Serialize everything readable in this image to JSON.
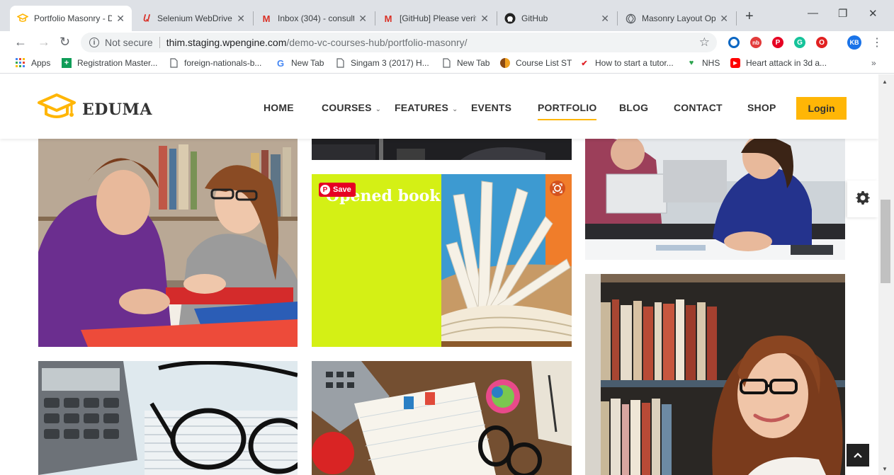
{
  "browser": {
    "tabs": [
      {
        "title": "Portfolio Masonry - D",
        "icon": "eduma-cap-icon",
        "active": true
      },
      {
        "title": "Selenium WebDriver",
        "icon": "selenium-icon",
        "active": false
      },
      {
        "title": "Inbox (304) - consult",
        "icon": "gmail-icon",
        "active": false
      },
      {
        "title": "[GitHub] Please verif",
        "icon": "gmail-icon",
        "active": false
      },
      {
        "title": "GitHub",
        "icon": "github-icon",
        "active": false
      },
      {
        "title": "Masonry Layout Opt",
        "icon": "globe-icon",
        "active": false
      }
    ],
    "address": {
      "security": "Not secure",
      "host": "thim.staging.wpengine.com",
      "path": "/demo-vc-courses-hub/portfolio-masonry/"
    },
    "profile_initials": "KB",
    "bookmarks": [
      {
        "label": "Apps",
        "icon": "apps-grid-icon"
      },
      {
        "label": "Registration Master...",
        "icon": "plus-square-icon"
      },
      {
        "label": "foreign-nationals-b...",
        "icon": "page-icon"
      },
      {
        "label": "New Tab",
        "icon": "google-icon"
      },
      {
        "label": "Singam 3 (2017) H...",
        "icon": "page-icon"
      },
      {
        "label": "New Tab",
        "icon": "page-icon"
      },
      {
        "label": "Course List ST",
        "icon": "brown-circle-icon"
      },
      {
        "label": "How to start a tutor...",
        "icon": "red-swoosh-icon"
      },
      {
        "label": "NHS",
        "icon": "shield-green-icon"
      },
      {
        "label": "Heart attack in 3d a...",
        "icon": "youtube-icon"
      }
    ],
    "bookmarks_more": "»"
  },
  "site": {
    "logo_text": "EDUMA",
    "nav": [
      {
        "label": "HOME"
      },
      {
        "label": "COURSES",
        "has_dropdown": true
      },
      {
        "label": "FEATURES",
        "has_dropdown": true
      },
      {
        "label": "EVENTS"
      },
      {
        "label": "PORTFOLIO",
        "current": true
      },
      {
        "label": "BLOG"
      },
      {
        "label": "CONTACT"
      },
      {
        "label": "SHOP"
      }
    ],
    "login_label": "Login",
    "accent_color": "#ffb606",
    "portfolio": {
      "featured_title": "Opened book",
      "save_label": "Save"
    }
  }
}
